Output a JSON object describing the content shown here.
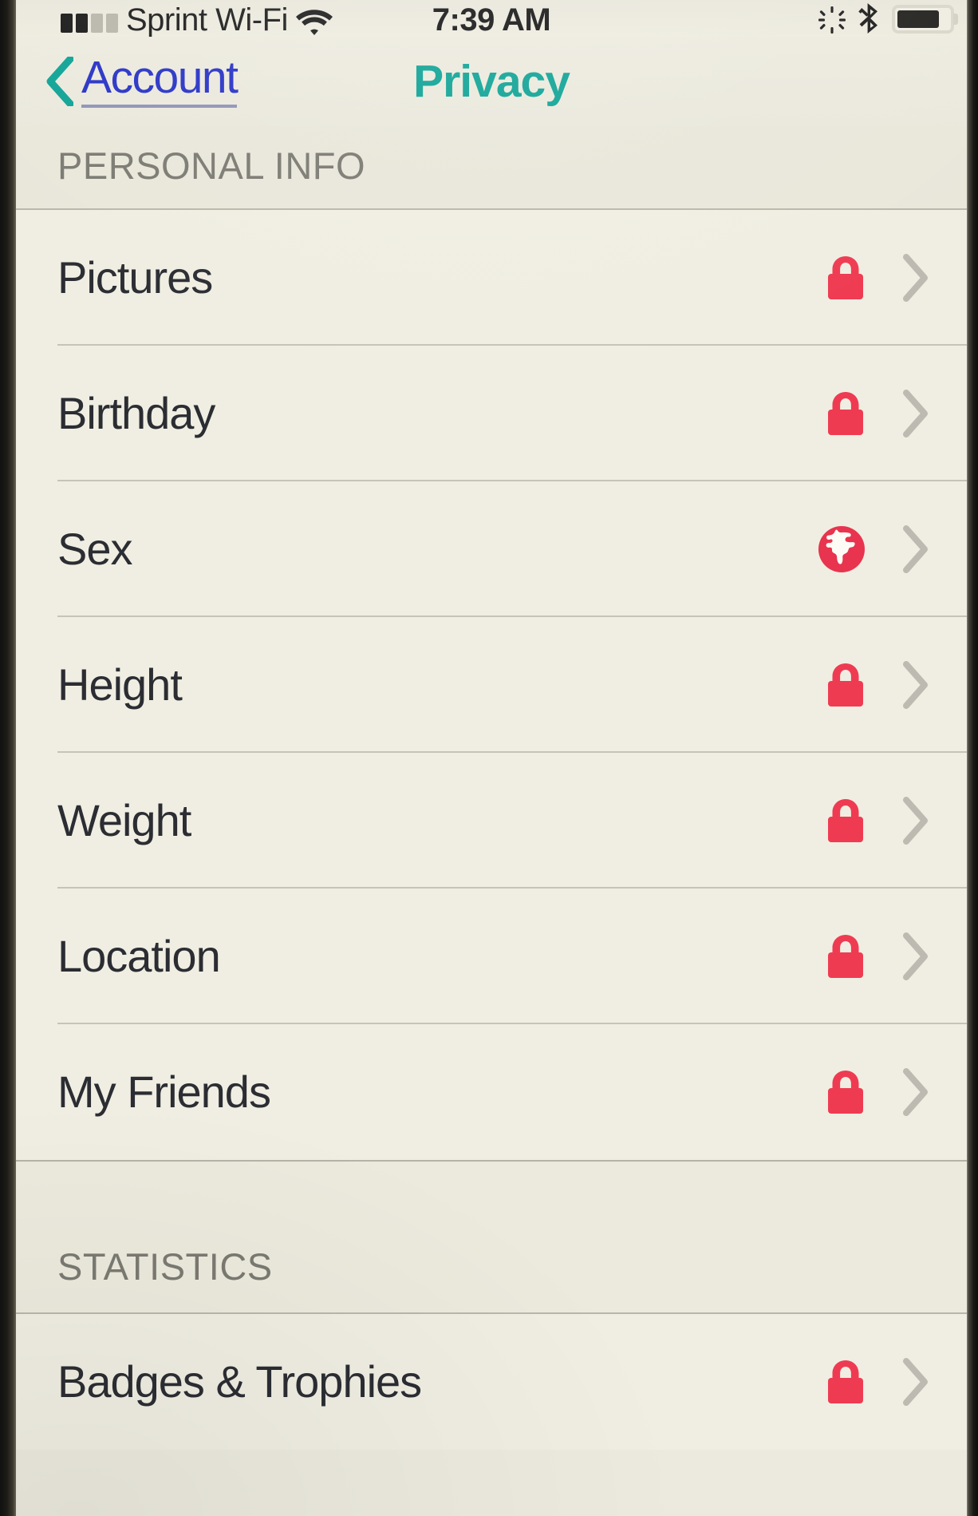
{
  "status_bar": {
    "carrier": "Sprint Wi-Fi",
    "time": "7:39 AM",
    "signal_bars_filled": 2,
    "signal_bars_total": 4,
    "wifi_icon": "wifi-icon",
    "rotation_lock_icon": "rotation-lock-icon",
    "bluetooth_icon": "bluetooth-icon",
    "battery_icon": "battery-icon",
    "battery_percent": 82
  },
  "nav": {
    "back_label": "Account",
    "back_icon": "chevron-left-icon",
    "title": "Privacy"
  },
  "sections": [
    {
      "header": "PERSONAL INFO",
      "rows": [
        {
          "label": "Pictures",
          "privacy_icon": "lock-icon",
          "privacy": "private",
          "chevron": "chevron-right-icon"
        },
        {
          "label": "Birthday",
          "privacy_icon": "lock-icon",
          "privacy": "private",
          "chevron": "chevron-right-icon"
        },
        {
          "label": "Sex",
          "privacy_icon": "globe-icon",
          "privacy": "public",
          "chevron": "chevron-right-icon"
        },
        {
          "label": "Height",
          "privacy_icon": "lock-icon",
          "privacy": "private",
          "chevron": "chevron-right-icon"
        },
        {
          "label": "Weight",
          "privacy_icon": "lock-icon",
          "privacy": "private",
          "chevron": "chevron-right-icon"
        },
        {
          "label": "Location",
          "privacy_icon": "lock-icon",
          "privacy": "private",
          "chevron": "chevron-right-icon"
        },
        {
          "label": "My Friends",
          "privacy_icon": "lock-icon",
          "privacy": "private",
          "chevron": "chevron-right-icon"
        }
      ]
    },
    {
      "header": "STATISTICS",
      "rows": [
        {
          "label": "Badges & Trophies",
          "privacy_icon": "lock-icon",
          "privacy": "private",
          "chevron": "chevron-right-icon"
        }
      ]
    }
  ],
  "colors": {
    "accent_teal": "#0fa396",
    "link_blue": "#2732c6",
    "privacy_red": "#ef3b52",
    "screen_bg": "#eceadd",
    "row_bg": "#f0eee2",
    "header_text": "#7b7a72",
    "row_text": "#2b2d33",
    "chevron_gray": "#bdbbb1",
    "separator": "#c6c4b8"
  }
}
